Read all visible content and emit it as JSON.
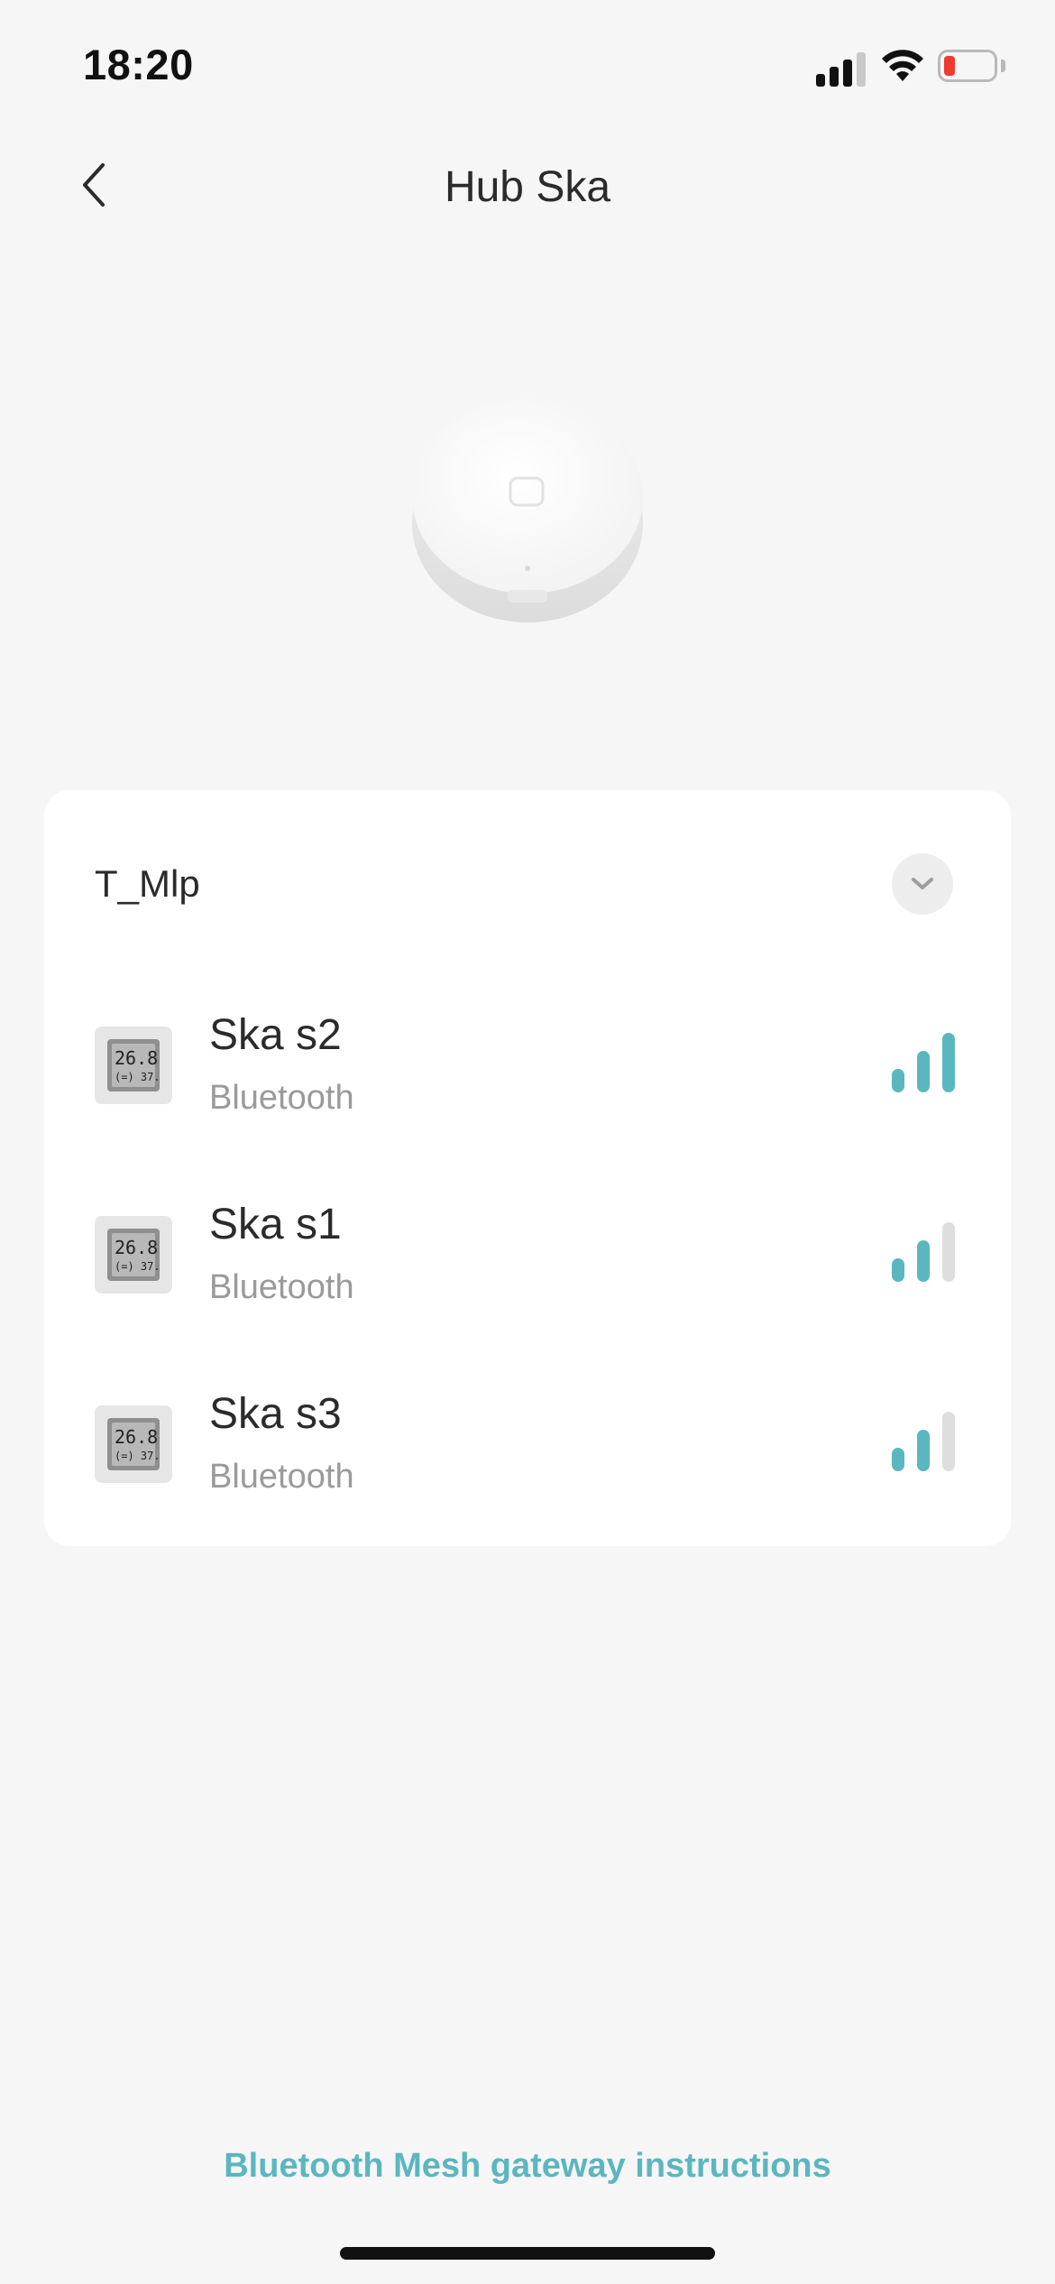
{
  "status_bar": {
    "time": "18:20",
    "cell_signal_bars_active": 3,
    "cell_signal_bars_total": 4,
    "battery_level": 0.1,
    "battery_color": "#ee3b2f"
  },
  "nav": {
    "back_icon": "chevron-left-icon",
    "title": "Hub Ska"
  },
  "hub": {
    "image": "mi-smart-hub-image"
  },
  "group": {
    "title": "T_Mlp",
    "expand_icon": "chevron-down-icon",
    "devices": [
      {
        "name": "Ska s2",
        "connection": "Bluetooth",
        "signal_level": 3,
        "signal_max": 3,
        "icon": "thermometer-hygrometer-icon"
      },
      {
        "name": "Ska s1",
        "connection": "Bluetooth",
        "signal_level": 2,
        "signal_max": 3,
        "icon": "thermometer-hygrometer-icon"
      },
      {
        "name": "Ska s3",
        "connection": "Bluetooth",
        "signal_level": 2,
        "signal_max": 3,
        "icon": "thermometer-hygrometer-icon"
      }
    ]
  },
  "footer": {
    "link": "Bluetooth Mesh gateway instructions"
  },
  "colors": {
    "accent": "#5cb6c0",
    "background": "#f6f6f6",
    "card": "#ffffff"
  }
}
